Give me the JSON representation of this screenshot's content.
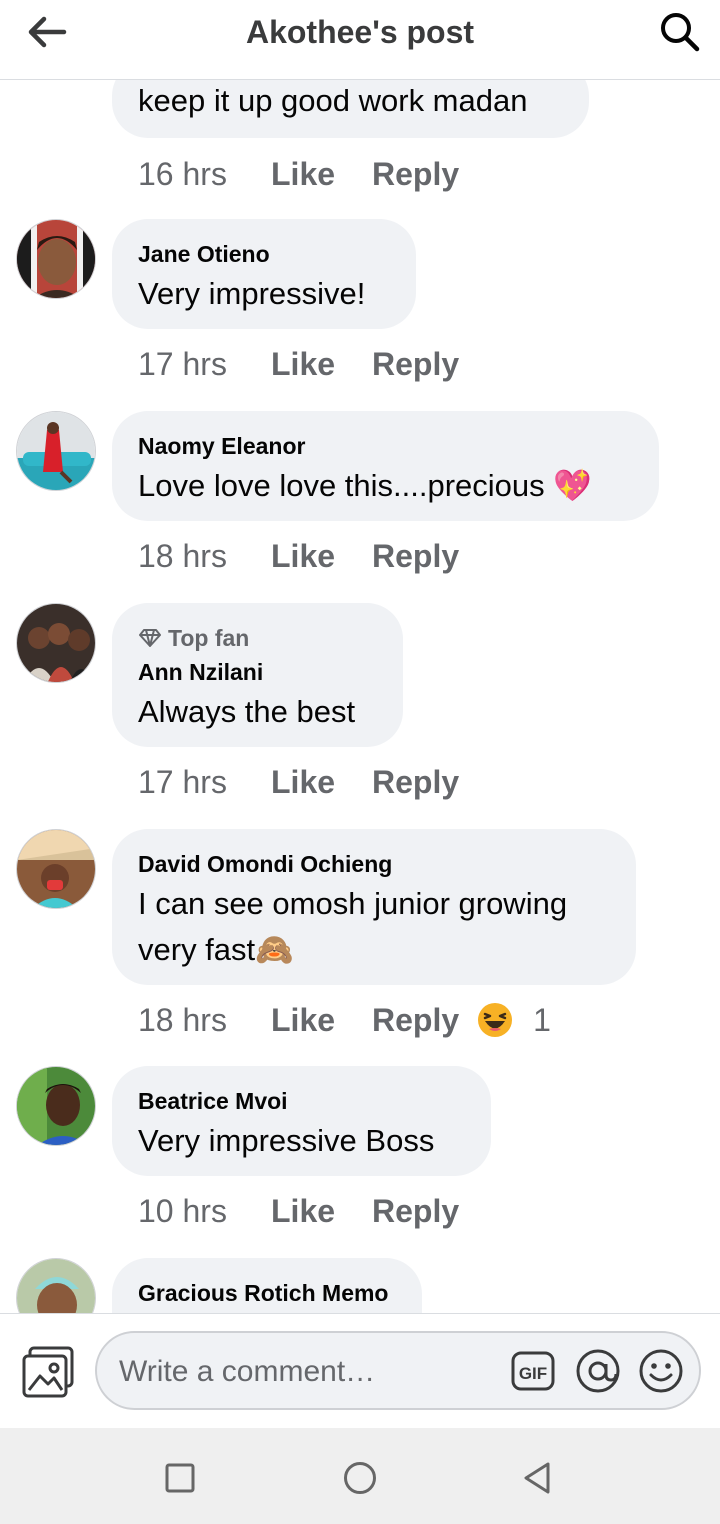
{
  "header": {
    "title": "Akothee's post"
  },
  "partial_comment": {
    "text": "keep it up good work madan",
    "time": "16 hrs"
  },
  "actions": {
    "like": "Like",
    "reply": "Reply"
  },
  "comments": [
    {
      "author": "Jane Otieno",
      "text": "Very impressive!",
      "time": "17 hrs"
    },
    {
      "author": "Naomy Eleanor",
      "text": "Love love love this....precious 💖",
      "time": "18 hrs"
    },
    {
      "badge": "Top fan",
      "author": "Ann Nzilani",
      "text": "Always the best",
      "time": "17 hrs"
    },
    {
      "author": "David Omondi Ochieng",
      "text_line1": "I can see omosh junior growing",
      "text_line2": "very fast🙈",
      "time": "18 hrs",
      "reaction_count": "1"
    },
    {
      "author": "Beatrice Mvoi",
      "text": "Very impressive Boss",
      "time": "10 hrs"
    },
    {
      "author": "Gracious Rotich Memo"
    }
  ],
  "composer": {
    "placeholder": "Write a comment…",
    "gif_label": "GIF"
  },
  "colors": {
    "bubble": "#f0f2f5",
    "secondary_text": "#65676b",
    "reaction_emoji": "#f7b125"
  },
  "icons": [
    "back-arrow-icon",
    "search-icon",
    "photo-icon",
    "gif-icon",
    "at-sign-icon",
    "emoji-icon",
    "diamond-icon",
    "laughing-reaction-icon",
    "square-nav-icon",
    "circle-nav-icon",
    "triangle-back-nav-icon"
  ]
}
